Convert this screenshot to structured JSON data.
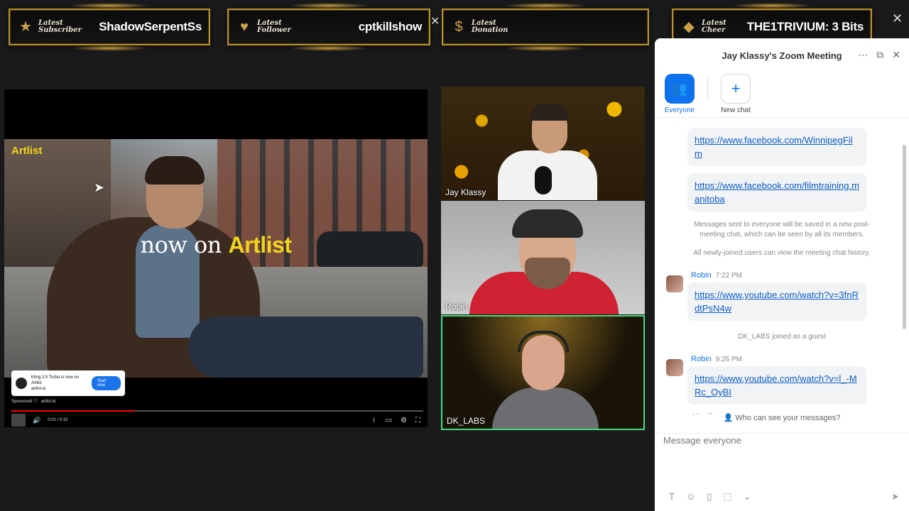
{
  "banners": [
    {
      "label_line1": "Latest",
      "label_line2": "Subscriber",
      "value": "ShadowSerpentSs",
      "icon": "star-icon"
    },
    {
      "label_line1": "Latest",
      "label_line2": "Follower",
      "value": "cptkillshow",
      "icon": "heart-icon"
    },
    {
      "label_line1": "Latest",
      "label_line2": "Donation",
      "value": "",
      "icon": "dollar-icon"
    },
    {
      "label_line1": "Latest",
      "label_line2": "Cheer",
      "value": "THE1TRIVIUM: 3 Bits",
      "icon": "diamond-icon"
    }
  ],
  "video": {
    "brand": "Artlist",
    "tagline_prefix": "now on",
    "tagline_brand": "Artlist",
    "ad_text": "Kling 2.5 Turbo is now on Artlist",
    "ad_domain": "artlist.io",
    "ad_button": "Start now",
    "sponsored_label": "Sponsored",
    "sponsored_domain": "artlist.io",
    "time_readout": "0:01 / 0:32",
    "progress": 0.3
  },
  "participants": [
    {
      "name": "Jay Klassy"
    },
    {
      "name": "Robin"
    },
    {
      "name": "DK_LABS",
      "active_speaker": true
    }
  ],
  "chat": {
    "meeting_title": "Jay Klassy's Zoom Meeting",
    "tabs": [
      {
        "label": "Everyone",
        "icon": "people-icon",
        "selected": true
      },
      {
        "label": "New chat",
        "icon": "plus-icon"
      }
    ],
    "messages": {
      "link1": "https://www.facebook.com/WinnipegFilm",
      "link2": "https://www.facebook.com/filmtraining.manitoba",
      "notice1": "Messages sent to everyone will be saved in a new post-meeting chat, which can be seen by all its members.",
      "notice2": "All newly-joined users can view the meeting chat history.",
      "msg3_sender": "Robin",
      "msg3_time": "7:22 PM",
      "msg3_link": "https://www.youtube.com/watch?v=3fnRdtPsN4w",
      "join_notice": "DK_LABS joined as a guest",
      "msg4_sender": "Robin",
      "msg4_time": "9:26 PM",
      "msg4_link": "https://www.youtube.com/watch?v=l_-MRc_OyBI"
    },
    "who_can_see": "Who can see your messages?",
    "compose_placeholder": "Message everyone"
  },
  "colors": {
    "accent": "#0e72ed",
    "active_speaker_border": "#3ee07a",
    "banner_gold": "#b8902e",
    "artlist_yellow": "#f2d41c"
  }
}
